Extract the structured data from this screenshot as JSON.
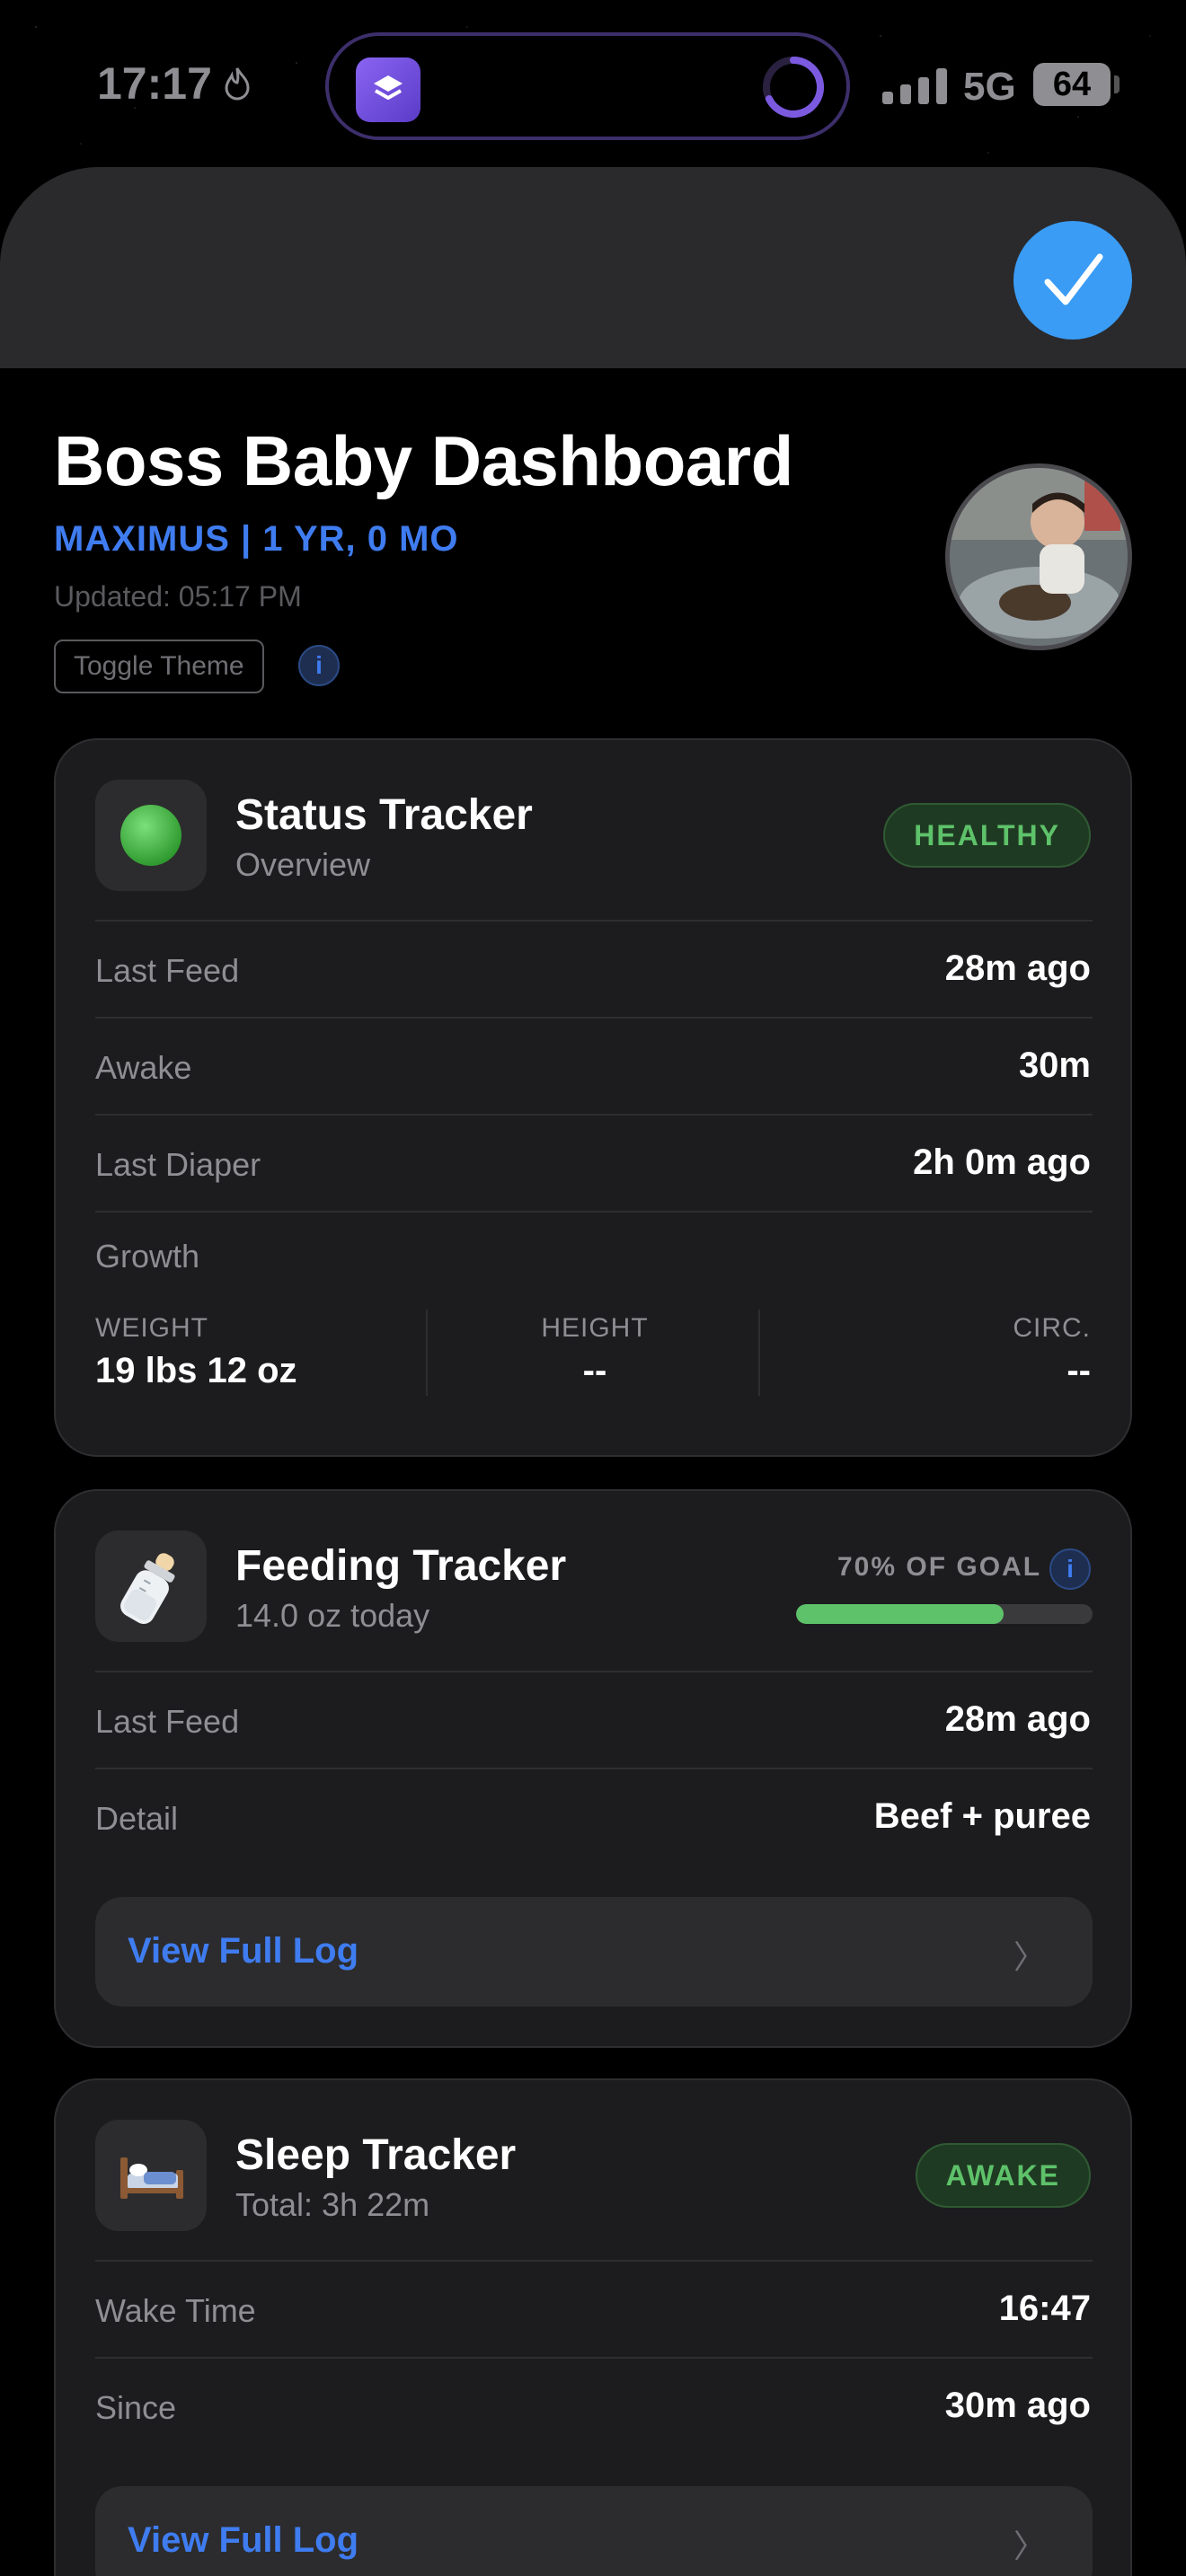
{
  "status_bar": {
    "time": "17:17",
    "network": "5G",
    "battery": "64"
  },
  "header": {
    "title": "Boss Baby Dashboard",
    "subtitle": "MAXIMUS | 1 YR, 0 MO",
    "updated": "Updated: 05:17 PM",
    "toggle_theme": "Toggle Theme",
    "info": "i"
  },
  "status_card": {
    "title": "Status Tracker",
    "subtitle": "Overview",
    "badge": "HEALTHY",
    "rows": [
      {
        "label": "Last Feed",
        "value": "28m ago"
      },
      {
        "label": "Awake",
        "value": "30m"
      },
      {
        "label": "Last Diaper",
        "value": "2h 0m ago"
      }
    ],
    "growth_label": "Growth",
    "growth": [
      {
        "label": "WEIGHT",
        "value": "19 lbs 12 oz"
      },
      {
        "label": "HEIGHT",
        "value": "--"
      },
      {
        "label": "CIRC.",
        "value": "--"
      }
    ]
  },
  "feeding_card": {
    "title": "Feeding Tracker",
    "subtitle": "14.0 oz today",
    "goal_label": "70% OF GOAL",
    "goal_progress": 0.7,
    "info": "i",
    "rows": [
      {
        "label": "Last Feed",
        "value": "28m ago"
      },
      {
        "label": "Detail",
        "value": "Beef + puree"
      }
    ],
    "log_button": "View Full Log",
    "chevron": "〉"
  },
  "sleep_card": {
    "title": "Sleep Tracker",
    "subtitle": "Total: 3h 22m",
    "badge": "AWAKE",
    "rows": [
      {
        "label": "Wake Time",
        "value": "16:47"
      },
      {
        "label": "Since",
        "value": "30m ago"
      }
    ],
    "log_button": "View Full Log",
    "chevron": "〉"
  },
  "colors": {
    "accent": "#3f7cf0",
    "healthy_green": "#5ec26a",
    "card_bg": "#1c1c1e",
    "done_blue": "#3a9cf5"
  },
  "icons": {
    "status": "green-circle-icon",
    "feeding": "baby-bottle-icon",
    "sleep": "bed-icon"
  }
}
